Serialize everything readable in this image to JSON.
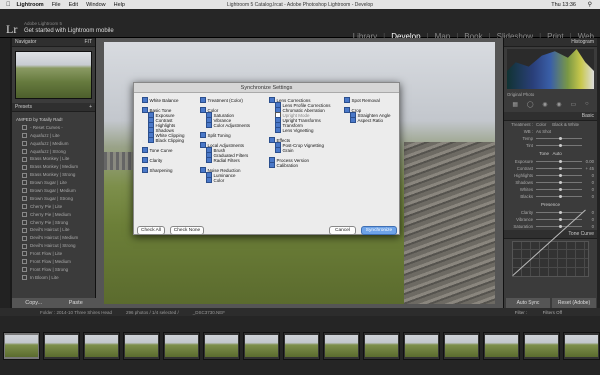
{
  "menubar": {
    "app": "Lightroom",
    "file": "File",
    "edit": "Edit",
    "window": "Window",
    "help": "Help",
    "title": "Lightroom 5 Catalog.lrcat - Adobe Photoshop Lightroom - Develop",
    "clock": "Thu 13:36"
  },
  "identity": {
    "logo": "Lr",
    "line1": "Adobe Lightroom 5",
    "line2": "Get started with Lightroom mobile"
  },
  "modules": [
    "Library",
    "Develop",
    "Map",
    "Book",
    "Slideshow",
    "Print",
    "Web"
  ],
  "left": {
    "navigator": "Navigator",
    "presets": "Presets",
    "preset_items": [
      "AMPED by Totally Rad!",
      "- Reset Curves -",
      "Aquafuzz | Lite",
      "Aquafuzz | Medium",
      "Aquafuzz | Strong",
      "Brass Monkey | Lite",
      "Brass Monkey | Medium",
      "Brass Monkey | Strong",
      "Brown Sugar | Lite",
      "Brown Sugar | Medium",
      "Brown Sugar | Strong",
      "Cherry Pie | Lite",
      "Cherry Pie | Medium",
      "Cherry Pie | Strong",
      "Devil's Haircut | Lite",
      "Devil's Haircut | Medium",
      "Devil's Haircut | Strong",
      "Front Flow | Lite",
      "Front Flow | Medium",
      "Front Flow | Strong",
      "In Bloom | Lite"
    ],
    "copy": "Copy...",
    "paste": "Paste"
  },
  "right": {
    "histogram": "Histogram",
    "original_photo": "Original Photo",
    "basic": "Basic",
    "treatment": "Treatment :",
    "color": "Color",
    "bw": "Black & White",
    "wb": "WB :",
    "as_shot": "As Shot",
    "tone": "Tone",
    "auto": "Auto",
    "presence": "Presence",
    "sliders": [
      {
        "n": "Temp",
        "v": ""
      },
      {
        "n": "Tint",
        "v": ""
      },
      {
        "n": "Exposure",
        "v": "0.00"
      },
      {
        "n": "Contrast",
        "v": "+ 45"
      },
      {
        "n": "Highlights",
        "v": "0"
      },
      {
        "n": "Shadows",
        "v": "0"
      },
      {
        "n": "Whites",
        "v": "0"
      },
      {
        "n": "Blacks",
        "v": "0"
      },
      {
        "n": "Clarity",
        "v": "0"
      },
      {
        "n": "Vibrance",
        "v": "0"
      },
      {
        "n": "Saturation",
        "v": "0"
      }
    ],
    "tone_curve": "Tone Curve",
    "auto_sync": "Auto Sync",
    "reset": "Reset (Adobe)"
  },
  "toolbar": {
    "folder": "Folder : 2014-10 Three Shires Head",
    "count": "296 photos / 1/4 selected /",
    "file": "_DSC3730.NEF",
    "filter": "Filter :",
    "filters_off": "Filters Off"
  },
  "dialog": {
    "title": "Synchronize Settings",
    "col1": [
      {
        "l": "White Balance",
        "on": true
      },
      {
        "l": "Basic Tone",
        "on": true
      },
      {
        "l": "Exposure",
        "on": true
      },
      {
        "l": "Contrast",
        "on": true
      },
      {
        "l": "Highlights",
        "on": true
      },
      {
        "l": "Shadows",
        "on": true
      },
      {
        "l": "White Clipping",
        "on": true
      },
      {
        "l": "Black Clipping",
        "on": true
      },
      {
        "l": "Tone Curve",
        "on": true
      },
      {
        "l": "Clarity",
        "on": true
      },
      {
        "l": "Sharpening",
        "on": true
      }
    ],
    "col2": [
      {
        "l": "Treatment (Color)",
        "on": true
      },
      {
        "l": "Color",
        "on": true
      },
      {
        "l": "Saturation",
        "on": true
      },
      {
        "l": "Vibrance",
        "on": true
      },
      {
        "l": "Color Adjustments",
        "on": true
      },
      {
        "l": "Split Toning",
        "on": true
      },
      {
        "l": "Local Adjustments",
        "on": true
      },
      {
        "l": "Brush",
        "on": true
      },
      {
        "l": "Graduated Filters",
        "on": true
      },
      {
        "l": "Radial Filters",
        "on": true
      },
      {
        "l": "Noise Reduction",
        "on": true
      },
      {
        "l": "Luminance",
        "on": true
      },
      {
        "l": "Color",
        "on": true
      }
    ],
    "col3": [
      {
        "l": "Lens Corrections",
        "on": true
      },
      {
        "l": "Lens Profile Corrections",
        "on": true
      },
      {
        "l": "Chromatic Aberration",
        "on": true
      },
      {
        "l": "Upright Mode",
        "on": false
      },
      {
        "l": "Upright Transforms",
        "on": true
      },
      {
        "l": "Transform",
        "on": true
      },
      {
        "l": "Lens Vignetting",
        "on": true
      },
      {
        "l": "Effects",
        "on": true
      },
      {
        "l": "Post-Crop Vignetting",
        "on": true
      },
      {
        "l": "Grain",
        "on": true
      },
      {
        "l": "Process Version",
        "on": true
      },
      {
        "l": "Calibration",
        "on": true
      }
    ],
    "col4": [
      {
        "l": "Spot Removal",
        "on": true
      },
      {
        "l": "Crop",
        "on": true
      },
      {
        "l": "Straighten Angle",
        "on": true
      },
      {
        "l": "Aspect Ratio",
        "on": true
      }
    ],
    "check_all": "Check All",
    "check_none": "Check None",
    "cancel": "Cancel",
    "synchronize": "Synchronize"
  }
}
